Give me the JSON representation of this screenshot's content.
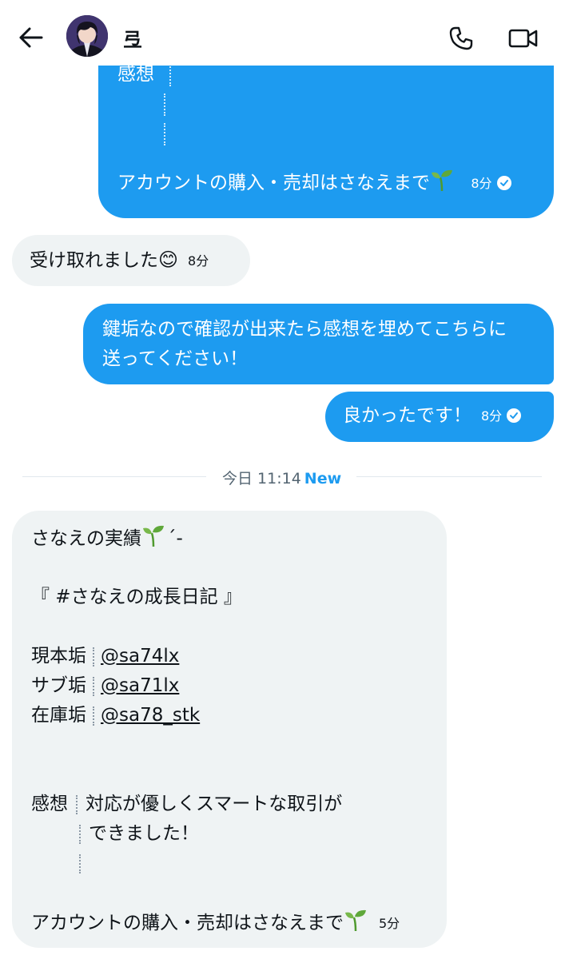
{
  "header": {
    "contact_name": "弖",
    "back_icon": "arrow-left-icon",
    "call_icon": "phone-icon",
    "video_icon": "video-camera-icon"
  },
  "messages": [
    {
      "direction": "out",
      "lines": [
        "感想",
        "",
        ""
      ],
      "last_line": "アカウントの購入・売却はさなえまで",
      "time": "8分",
      "read": true
    },
    {
      "direction": "in",
      "text": "受け取れました",
      "emoji": "😊",
      "time": "8分"
    },
    {
      "direction": "out",
      "line1": "鍵垢なので確認が出来たら感想を埋めてこちらに",
      "line2": "送ってください！"
    },
    {
      "direction": "out",
      "text": "良かったです！",
      "time": "8分",
      "read": true
    },
    {
      "direction": "in",
      "title": "さなえの実績",
      "title_suffix": "´-",
      "hashtag_line": "『 #さなえの成長日記 』",
      "accounts": [
        {
          "label": "現本垢",
          "handle": "@sa74lx"
        },
        {
          "label": "サブ垢",
          "handle": "@sa71lx"
        },
        {
          "label": "在庫垢",
          "handle": "@sa78_stk"
        }
      ],
      "impression_label": "感想",
      "impression_line1": "対応が優しくスマートな取引が",
      "impression_line2": "できました！",
      "footer": "アカウントの購入・売却はさなえまで",
      "time": "5分"
    }
  ],
  "divider": {
    "text": "今日 11:14",
    "new_label": "New"
  },
  "colors": {
    "accent": "#1d9bf0",
    "incoming_bubble": "#eff3f4",
    "text": "#0f1419",
    "muted": "#536471"
  }
}
